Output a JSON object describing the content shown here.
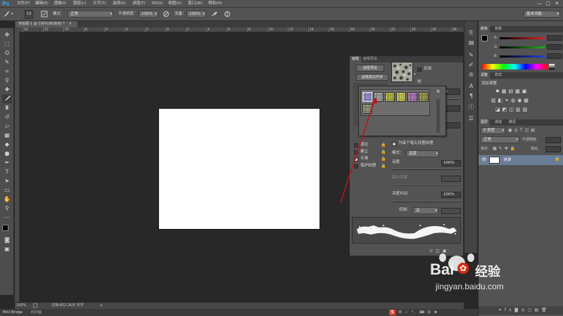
{
  "app": {
    "logo": "Ps"
  },
  "menubar": {
    "items": [
      "文件(F)",
      "编辑(E)",
      "图像(I)",
      "图层(L)",
      "文字(Y)",
      "选择(S)",
      "滤镜(T)",
      "3D(D)",
      "视图(V)",
      "窗口(W)",
      "帮助(H)"
    ],
    "win_controls": [
      "—",
      "□",
      "✕"
    ]
  },
  "options_bar": {
    "brush_size": "13",
    "mode_label": "模式：",
    "mode_value": "正常",
    "opacity_label": "不透明度：",
    "opacity_value": "100%",
    "flow_label": "流量：",
    "flow_value": "100%",
    "workspace": "基本功能"
  },
  "document": {
    "tab_title": "未标题-1 @ 100%(RGB/8) *",
    "tab_close": "×"
  },
  "ruler": {
    "labels": [
      "14",
      "12",
      "10",
      "8",
      "6",
      "4",
      "2",
      "0",
      "2",
      "4",
      "6",
      "8",
      "10",
      "12",
      "14",
      "16",
      "18",
      "20",
      "22",
      "24",
      "26",
      "28"
    ]
  },
  "statusbar": {
    "zoom": "100%",
    "doc_info": "文档:452.2K/0 字节"
  },
  "bottombar": {
    "tabs": [
      "Mini Bridge",
      "时间轴"
    ]
  },
  "brush_panel": {
    "tabs": [
      "画笔",
      "画笔预设"
    ],
    "preset_button": "画笔预设",
    "tip_shape_button": "画笔笔尖形状",
    "flip_label": "反相",
    "percent_label": "%",
    "left_options": [
      {
        "label": "湿边",
        "checked": false
      },
      {
        "label": "建立",
        "checked": false
      },
      {
        "label": "平滑",
        "checked": true
      },
      {
        "label": "保护纹理",
        "checked": false
      }
    ],
    "texture_each_tip": "为每个笔尖设置纹理",
    "mode_label": "模式：",
    "mode_value": "高度",
    "depth_label": "深度",
    "depth_value": "100%",
    "min_depth_label": "最小深度",
    "depth_jitter_label": "深度抖动",
    "depth_jitter_value": "100%",
    "control_label": "控制：",
    "control_value": "关"
  },
  "pattern_picker": {
    "swatch_colors": [
      "#8e8bcf",
      "#9a9a9a",
      "#a8b22e",
      "#c0c442",
      "#a86ab2",
      "#8a8f3a",
      "#8c8a6a"
    ]
  },
  "color_panel": {
    "tabs": [
      "颜色",
      "色板"
    ],
    "channels": [
      {
        "label": "R",
        "value": "",
        "color": "#e02020"
      },
      {
        "label": "G",
        "value": "",
        "color": "#20b020"
      },
      {
        "label": "B",
        "value": "",
        "color": "#2040e0"
      }
    ]
  },
  "adjust_panel": {
    "tabs": [
      "调整",
      "样式"
    ],
    "title": "添加调整"
  },
  "layers_panel": {
    "tabs": [
      "图层",
      "通道",
      "路径"
    ],
    "kind_label": "P 类型",
    "blend_value": "正常",
    "opacity_label": "不透明度:",
    "lock_label": "锁定:",
    "fill_label": "填充:",
    "layer_name": "背景"
  },
  "watermark": {
    "brand": "Bai",
    "brand_suffix": "经验",
    "url": "jingyan.baidu.com"
  },
  "accent_colors": {
    "ps_blue": "#2fa1e8",
    "baidu_red": "#de2910",
    "arrow_red": "#c0141c"
  }
}
